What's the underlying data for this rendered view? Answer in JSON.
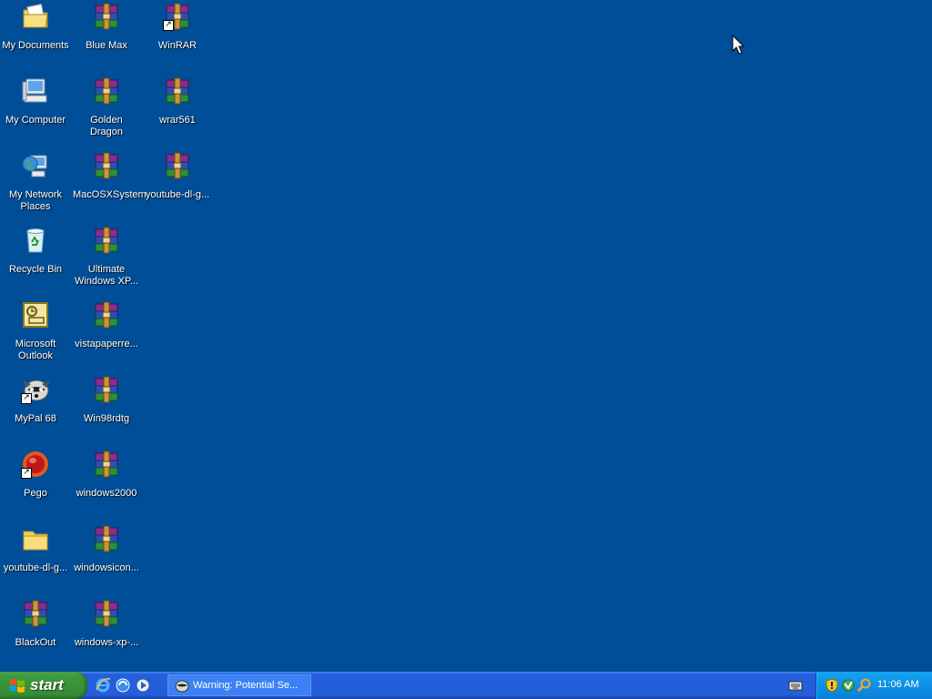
{
  "desktop": {
    "background_color": "#004e98",
    "icons": [
      {
        "label": "My Documents",
        "icon": "my-documents-icon"
      },
      {
        "label": "Blue Max",
        "icon": "winrar-archive-icon"
      },
      {
        "label": "WinRAR",
        "icon": "winrar-shortcut-icon"
      },
      {
        "label": "My Computer",
        "icon": "my-computer-icon"
      },
      {
        "label": "Golden Dragon",
        "icon": "winrar-archive-icon"
      },
      {
        "label": "wrar561",
        "icon": "winrar-installer-icon"
      },
      {
        "label": "My Network Places",
        "icon": "network-places-icon"
      },
      {
        "label": "MacOSXSystem",
        "icon": "winrar-archive-icon"
      },
      {
        "label": "youtube-dl-g...",
        "icon": "winrar-archive-icon"
      },
      {
        "label": "Recycle Bin",
        "icon": "recycle-bin-icon"
      },
      {
        "label": "Ultimate Windows XP...",
        "icon": "winrar-archive-icon"
      },
      {
        "label": "Microsoft Outlook",
        "icon": "outlook-icon"
      },
      {
        "label": "vistapaperre...",
        "icon": "winrar-archive-icon"
      },
      {
        "label": "MyPal 68",
        "icon": "mypal-icon"
      },
      {
        "label": "Win98rdtg",
        "icon": "winrar-archive-icon"
      },
      {
        "label": "Pego",
        "icon": "pego-icon"
      },
      {
        "label": "windows2000",
        "icon": "winrar-archive-icon"
      },
      {
        "label": "youtube-dl-g...",
        "icon": "folder-icon"
      },
      {
        "label": "windowsicon...",
        "icon": "winrar-archive-icon"
      },
      {
        "label": "BlackOut",
        "icon": "winrar-archive-icon"
      },
      {
        "label": "windows-xp-...",
        "icon": "winrar-archive-icon"
      }
    ]
  },
  "taskbar": {
    "start_label": "start",
    "quicklaunch": [
      "internet-explorer-icon",
      "outlook-express-icon",
      "media-player-icon"
    ],
    "task_button_label": "Warning: Potential Se...",
    "tray_icons": [
      "security-shield-icon",
      "network-icon",
      "search-icon"
    ],
    "clock": "11:06 AM"
  }
}
